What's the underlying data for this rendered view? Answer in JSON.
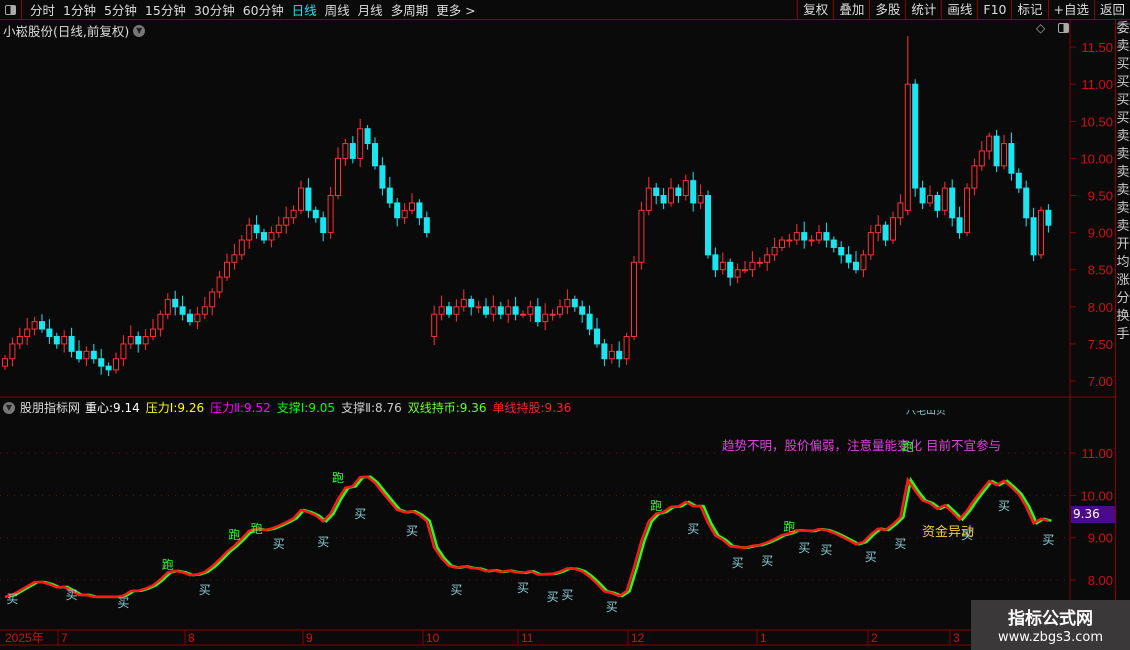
{
  "toolbar": {
    "periods": [
      "分时",
      "1分钟",
      "5分钟",
      "15分钟",
      "30分钟",
      "60分钟",
      "日线",
      "周线",
      "月线",
      "多周期",
      "更多 >"
    ],
    "active_period": "日线",
    "right_buttons": [
      "复权",
      "叠加",
      "多股",
      "统计",
      "画线",
      "F10",
      "标记",
      "+自选",
      "返回"
    ]
  },
  "chart_title": "小崧股份(日线,前复权)",
  "price_axis": [
    "11.50",
    "11.00",
    "10.50",
    "10.00",
    "9.50",
    "9.00",
    "8.50",
    "8.00",
    "7.50",
    "7.00"
  ],
  "indicator": {
    "name": "股朋指标网",
    "items": [
      {
        "label": "重心:",
        "value": "9.14",
        "color": "#ffffff"
      },
      {
        "label": "压力Ⅰ:",
        "value": "9.26",
        "color": "#ffff00"
      },
      {
        "label": "压力Ⅱ:",
        "value": "9.52",
        "color": "#ff00ff"
      },
      {
        "label": "支撑Ⅰ:",
        "value": "9.05",
        "color": "#00ff00"
      },
      {
        "label": "支撑Ⅱ:",
        "value": "8.76",
        "color": "#cccccc"
      },
      {
        "label": "双线持币:",
        "value": "9.36",
        "color": "#66ff33"
      },
      {
        "label": "单线持股:",
        "value": "9.36",
        "color": "#ff2020"
      }
    ],
    "axis": [
      "11.00",
      "10.00",
      "9.00",
      "8.00"
    ],
    "current_value": "9.36",
    "message": "趋势不明，股价偏弱，注意量能变化 目前不宜参与",
    "signal_text": "资金异动",
    "top_cut_text": "八毛山贝",
    "labels": [
      {
        "i": 1,
        "t": "买",
        "p": 7.6
      },
      {
        "i": 9,
        "t": "买",
        "p": 7.7
      },
      {
        "i": 16,
        "t": "买",
        "p": 7.5
      },
      {
        "i": 22,
        "t": "跑",
        "p": 8.4
      },
      {
        "i": 27,
        "t": "买",
        "p": 7.8
      },
      {
        "i": 31,
        "t": "跑",
        "p": 9.1
      },
      {
        "i": 34,
        "t": "跑",
        "p": 9.25
      },
      {
        "i": 37,
        "t": "买",
        "p": 8.9
      },
      {
        "i": 43,
        "t": "买",
        "p": 8.95
      },
      {
        "i": 45,
        "t": "跑",
        "p": 10.45
      },
      {
        "i": 48,
        "t": "买",
        "p": 9.6
      },
      {
        "i": 55,
        "t": "买",
        "p": 9.2
      },
      {
        "i": 61,
        "t": "买",
        "p": 7.8
      },
      {
        "i": 70,
        "t": "买",
        "p": 7.85
      },
      {
        "i": 74,
        "t": "买",
        "p": 7.65
      },
      {
        "i": 76,
        "t": "买",
        "p": 7.7
      },
      {
        "i": 82,
        "t": "买",
        "p": 7.4
      },
      {
        "i": 88,
        "t": "跑",
        "p": 9.8
      },
      {
        "i": 93,
        "t": "买",
        "p": 9.25
      },
      {
        "i": 99,
        "t": "买",
        "p": 8.45
      },
      {
        "i": 103,
        "t": "买",
        "p": 8.5
      },
      {
        "i": 106,
        "t": "跑",
        "p": 9.3
      },
      {
        "i": 108,
        "t": "买",
        "p": 8.8
      },
      {
        "i": 111,
        "t": "买",
        "p": 8.75
      },
      {
        "i": 117,
        "t": "买",
        "p": 8.6
      },
      {
        "i": 121,
        "t": "买",
        "p": 8.9
      },
      {
        "i": 122,
        "t": "跑",
        "p": 11.2
      },
      {
        "i": 130,
        "t": "买",
        "p": 9.1
      },
      {
        "i": 135,
        "t": "买",
        "p": 9.8
      },
      {
        "i": 141,
        "t": "买",
        "p": 9.0
      }
    ]
  },
  "time_axis": [
    "2025年",
    "7",
    "8",
    "9",
    "10",
    "11",
    "12",
    "1",
    "2",
    "3"
  ],
  "watermark": {
    "title": "指标公式网",
    "url": "www.zbgs3.com"
  },
  "right_strip": "委卖买买买买卖卖卖卖卖卖开均涨分换手",
  "colors": {
    "up": "#ff3030",
    "down": "#19e6f0",
    "grid": "#8b0000",
    "axis_text": "#d01010",
    "buy": "#8ccfd8",
    "run": "#33ff33"
  },
  "chart_data": {
    "type": "candlestick",
    "closes": [
      7.3,
      7.5,
      7.6,
      7.7,
      7.8,
      7.7,
      7.6,
      7.5,
      7.6,
      7.4,
      7.3,
      7.4,
      7.3,
      7.2,
      7.15,
      7.3,
      7.5,
      7.6,
      7.5,
      7.6,
      7.7,
      7.9,
      8.1,
      8.0,
      7.9,
      7.8,
      7.9,
      8.0,
      8.2,
      8.4,
      8.6,
      8.7,
      8.9,
      9.1,
      9.0,
      8.9,
      9.0,
      9.1,
      9.2,
      9.3,
      9.6,
      9.3,
      9.2,
      9.0,
      9.5,
      10.0,
      10.2,
      10.0,
      10.4,
      10.2,
      9.9,
      9.6,
      9.4,
      9.2,
      9.3,
      9.4,
      9.2,
      9.0,
      7.9,
      8.0,
      7.9,
      8.0,
      8.1,
      8.0,
      8.0,
      7.9,
      8.0,
      7.9,
      8.0,
      7.9,
      7.9,
      8.0,
      7.8,
      7.9,
      7.9,
      8.0,
      8.1,
      8.0,
      7.9,
      7.7,
      7.5,
      7.3,
      7.4,
      7.3,
      7.6,
      8.6,
      9.3,
      9.6,
      9.5,
      9.4,
      9.6,
      9.5,
      9.7,
      9.4,
      9.5,
      8.7,
      8.5,
      8.6,
      8.4,
      8.5,
      8.5,
      8.6,
      8.6,
      8.7,
      8.8,
      8.9,
      8.9,
      9.0,
      8.9,
      8.9,
      9.0,
      8.9,
      8.8,
      8.7,
      8.6,
      8.5,
      8.7,
      9.0,
      9.1,
      8.9,
      9.2,
      9.4,
      11.0,
      9.6,
      9.4,
      9.5,
      9.3,
      9.6,
      9.2,
      9.0,
      9.6,
      9.9,
      10.1,
      10.3,
      9.9,
      10.2,
      9.8,
      9.6,
      9.2,
      8.7,
      9.3,
      9.1
    ],
    "ylim": [
      6.85,
      11.75
    ]
  }
}
